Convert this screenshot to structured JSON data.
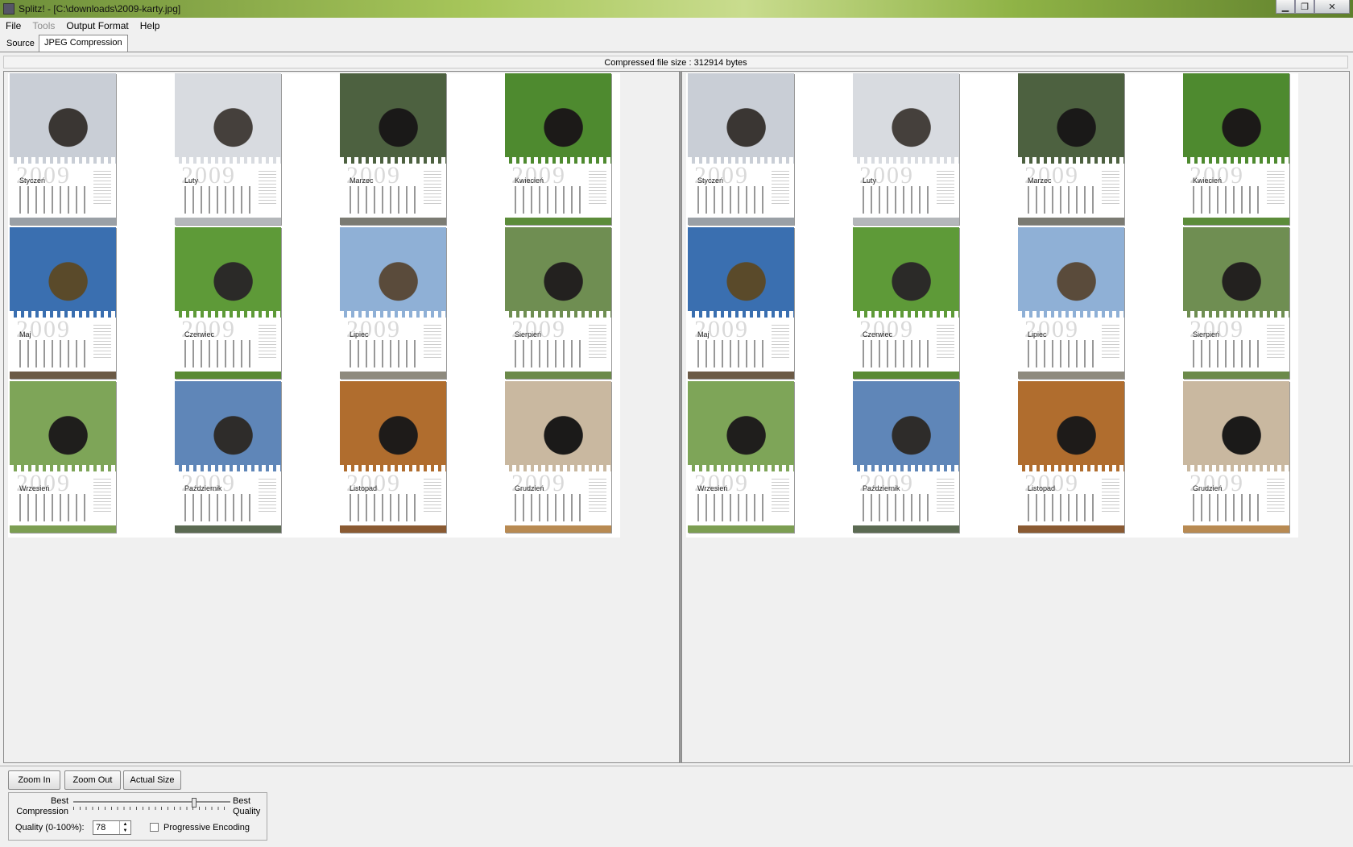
{
  "window": {
    "title": "Splitz! - [C:\\downloads\\2009-karty.jpg]",
    "min_glyph": "▁",
    "max_glyph": "❐",
    "close_glyph": "✕"
  },
  "menu": {
    "items": [
      {
        "label": "File",
        "enabled": true
      },
      {
        "label": "Tools",
        "enabled": false
      },
      {
        "label": "Output Format",
        "enabled": true
      },
      {
        "label": "Help",
        "enabled": true
      }
    ]
  },
  "tabs": [
    {
      "label": "Source",
      "active": false
    },
    {
      "label": "JPEG Compression",
      "active": true
    }
  ],
  "status": {
    "compressed_size": "Compressed file size : 312914 bytes"
  },
  "preview": {
    "cards": [
      {
        "month": "Styczeń",
        "photo": [
          "#c9ced6",
          "#3a3633"
        ],
        "foot": "#9aa0a6"
      },
      {
        "month": "Luty",
        "photo": [
          "#d8dbe0",
          "#45403c"
        ],
        "foot": "#b4b7ba"
      },
      {
        "month": "Marzec",
        "photo": [
          "#4d6140",
          "#1a1918"
        ],
        "foot": "#7b7b73"
      },
      {
        "month": "Kwiecień",
        "photo": [
          "#4e8a2f",
          "#1c1a18"
        ],
        "foot": "#5c8c3a"
      },
      {
        "month": "Maj",
        "photo": [
          "#3a6fb0",
          "#5a4a2a"
        ],
        "foot": "#6b5a46"
      },
      {
        "month": "Czerwiec",
        "photo": [
          "#5e9a38",
          "#2b2a28"
        ],
        "foot": "#5a8a34"
      },
      {
        "month": "Lipiec",
        "photo": [
          "#8fb0d6",
          "#5a4b3b"
        ],
        "foot": "#8e8a7e"
      },
      {
        "month": "Sierpień",
        "photo": [
          "#6f8e52",
          "#23211f"
        ],
        "foot": "#6c8a4a"
      },
      {
        "month": "Wrzesień",
        "photo": [
          "#7ea558",
          "#1f1e1c"
        ],
        "foot": "#7c9e52"
      },
      {
        "month": "Październik",
        "photo": [
          "#5f86b8",
          "#2e2c2a"
        ],
        "foot": "#5b6a52"
      },
      {
        "month": "Listopad",
        "photo": [
          "#b06d2e",
          "#1e1b19"
        ],
        "foot": "#8a5a32"
      },
      {
        "month": "Grudzień",
        "photo": [
          "#c9b8a0",
          "#1b1a19"
        ],
        "foot": "#b88a52"
      }
    ],
    "year": "2009"
  },
  "toolbar": {
    "zoom_in": "Zoom In",
    "zoom_out": "Zoom Out",
    "actual_size": "Actual Size"
  },
  "quality": {
    "best_compression": "Best\nCompression",
    "best_quality": "Best\nQuality",
    "label": "Quality (0-100%):",
    "value": "78",
    "value_fraction": 0.78,
    "progressive_label": "Progressive Encoding",
    "progressive_checked": false
  }
}
